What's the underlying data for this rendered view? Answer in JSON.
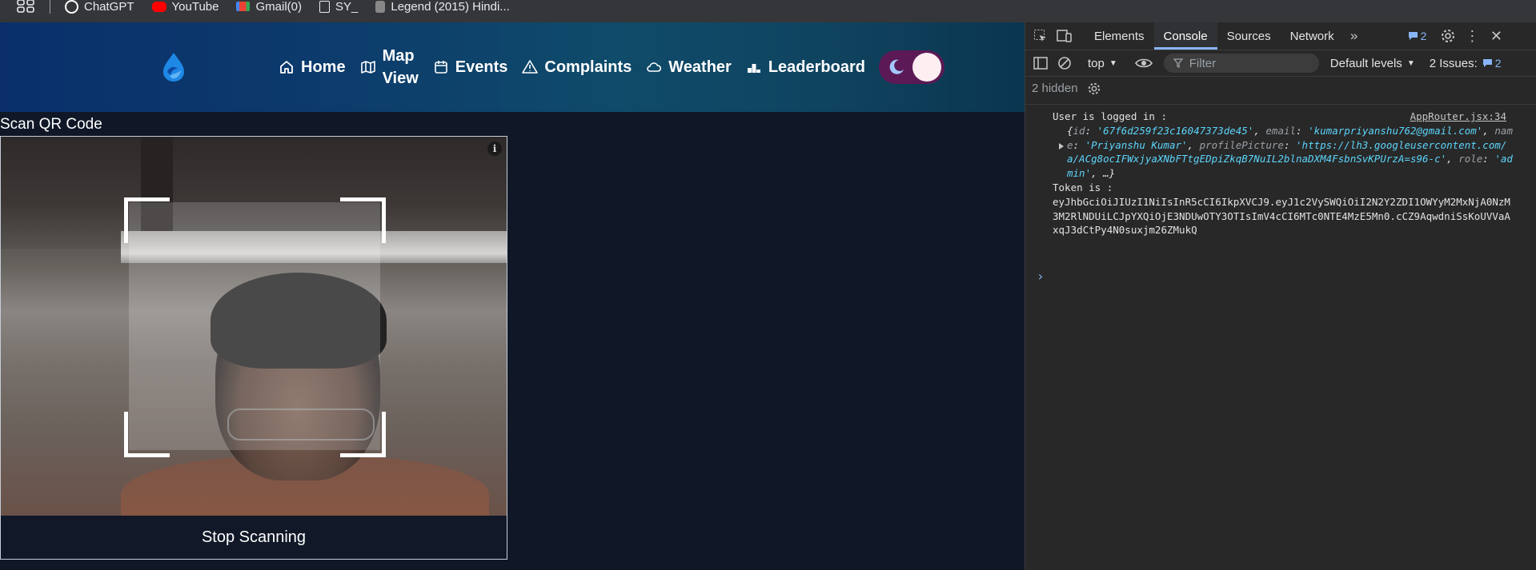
{
  "bookmarks": [
    {
      "label": "ChatGPT",
      "icon": "chatgpt-icon",
      "color": "#ffffff"
    },
    {
      "label": "YouTube",
      "icon": "youtube-icon",
      "color": "#ff0000"
    },
    {
      "label": "Gmail(0)",
      "icon": "gmail-icon",
      "color": "#ea4335"
    },
    {
      "label": "SY_",
      "icon": "document-icon",
      "color": "#e8eaed"
    },
    {
      "label": "Legend (2015) Hindi...",
      "icon": "site-icon",
      "color": "#bbbbbb"
    }
  ],
  "nav": {
    "home": "Home",
    "map_line1": "Map",
    "map_line2": "View",
    "events": "Events",
    "complaints": "Complaints",
    "weather": "Weather",
    "leaderboard": "Leaderboard"
  },
  "scanner": {
    "title": "Scan QR Code",
    "info": "i",
    "stop_label": "Stop Scanning"
  },
  "devtools": {
    "tabs": [
      "Elements",
      "Console",
      "Sources",
      "Network"
    ],
    "active_tab": "Console",
    "message_count": "2",
    "context": "top",
    "filter_placeholder": "Filter",
    "levels": "Default levels",
    "issues_label": "2 Issues:",
    "issues_count": "2",
    "hidden": "2 hidden",
    "logs": {
      "line1": "User is logged in :",
      "source": "AppRouter.jsx:34",
      "obj": {
        "id_key": "id",
        "id_val": "'67f6d259f23c16047373de45'",
        "email_key": "email",
        "email_val": "'kumarpriyanshu762@gmail.com'",
        "name_key": "name",
        "name_val": "'Priyanshu Kumar'",
        "pic_key": "profilePicture",
        "pic_val": "'https://lh3.googleusercontent.com/a/ACg8ocIFWxjyaXNbFTtgEDpiZkqB7NuIL2blnaDXM4FsbnSvKPUrzA=s96-c'",
        "role_key": "role",
        "role_val": "'admin'",
        "more": ", …}"
      },
      "token_label": "Token is :",
      "token": "eyJhbGciOiJIUzI1NiIsInR5cCI6IkpXVCJ9.eyJ1c2VySWQiOiI2N2Y2ZDI1OWYyM2MxNjA0NzM3M2RlNDUiLCJpYXQiOjE3NDUwOTY3OTIsImV4cCI6MTc0NTE4MzE5Mn0.cCZ9AqwdniSsKoUVVaAxqJ3dCtPy4N0suxjm26ZMukQ"
    }
  }
}
